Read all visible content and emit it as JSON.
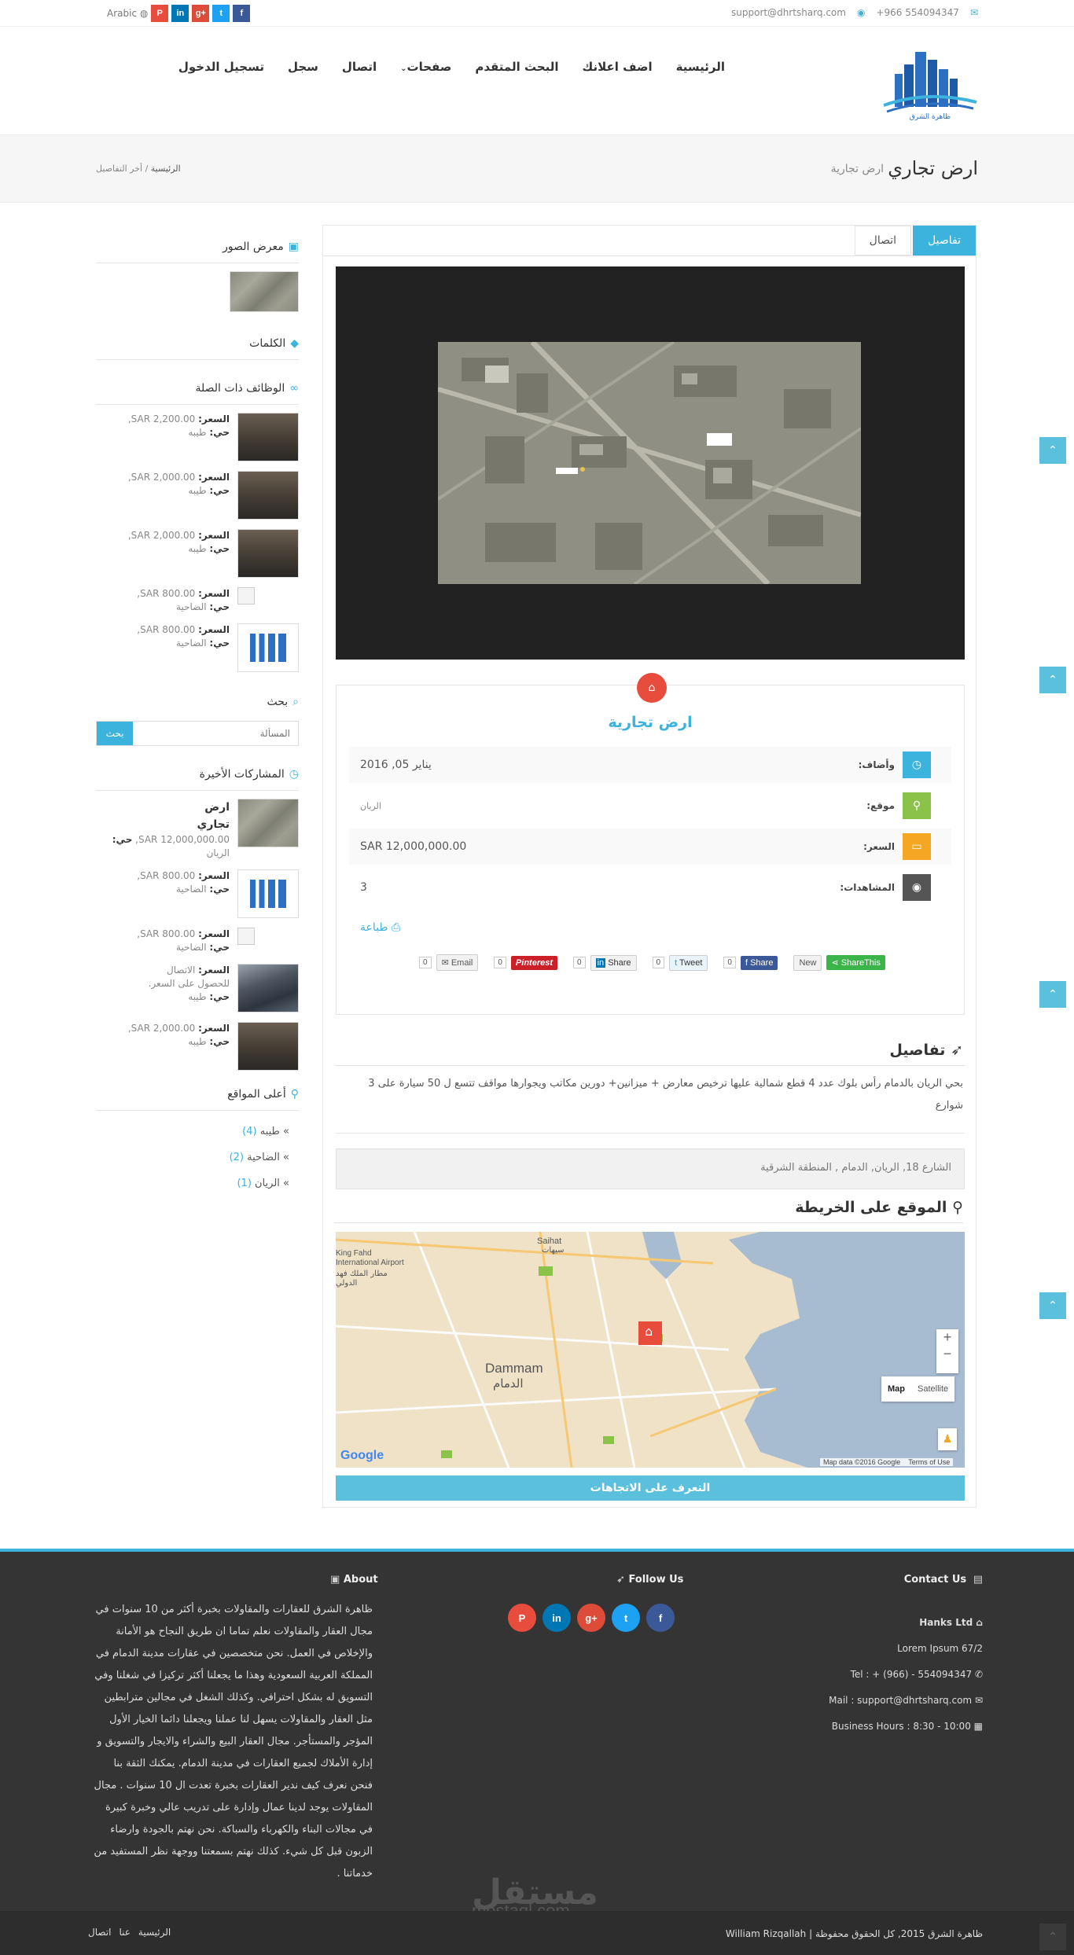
{
  "topbar": {
    "email": "support@dhrtsharq.com",
    "phone": "+966 554094347",
    "language": "Arabic",
    "socials": [
      "facebook-icon",
      "twitter-icon",
      "linkedin-icon",
      "google-plus-icon",
      "pinterest-icon"
    ]
  },
  "header": {
    "logo_alt": "ظاهرة الشرق",
    "nav": [
      "الرئيسية",
      "اضف اعلانك",
      "البحث المتقدم",
      "صفحات",
      "اتصال",
      "سجل",
      "تسجيل الدخول"
    ]
  },
  "title_band": {
    "title": "ارض تجاري",
    "subtitle": "ارض تجارية",
    "breadcrumb_home": "الرئيسية",
    "breadcrumb_sep": "/",
    "breadcrumb_current": "أخر التفاصيل"
  },
  "sidebar": {
    "gallery_title": "معرض الصور",
    "tags_title": "الكلمات",
    "related_title": "الوظائف ذات الصلة",
    "price_label": "السعر:",
    "district_label": "حي:",
    "related": [
      {
        "price": "SAR 2,200.00,",
        "district": "طيبه",
        "thumb": "room"
      },
      {
        "price": "SAR 2,000.00,",
        "district": "طيبه",
        "thumb": "room"
      },
      {
        "price": "SAR 2,000.00,",
        "district": "طيبه",
        "thumb": "room"
      },
      {
        "price": "SAR 800.00,",
        "district": "الضاحية",
        "thumb": "broken"
      },
      {
        "price": "SAR 800.00,",
        "district": "الضاحية",
        "thumb": "logo"
      }
    ],
    "search_title": "بحث",
    "search_placeholder": "المسألة",
    "search_button": "بحث",
    "recent_title": "المشاركات الأخيرة",
    "recent": [
      {
        "name": "ارض تجاري",
        "price": "SAR 12,000,000.00,",
        "district": "الريان",
        "thumb": "aerial"
      },
      {
        "name": "",
        "price": "SAR 800.00,",
        "district": "الضاحية",
        "thumb": "logo"
      },
      {
        "name": "",
        "price": "SAR 800.00,",
        "district": "الضاحية",
        "thumb": "broken"
      },
      {
        "name": "",
        "price": "الاتصال للحصول على السعر.",
        "district": "طيبه",
        "thumb": "building"
      },
      {
        "name": "",
        "price": "SAR 2,000.00,",
        "district": "طيبه",
        "thumb": "room"
      }
    ],
    "top_locations_title": "أعلى المواقع",
    "locations": [
      {
        "name": "طيبه",
        "count": "(4)"
      },
      {
        "name": "الضاحية",
        "count": "(2)"
      },
      {
        "name": "الريان",
        "count": "(1)"
      }
    ]
  },
  "main": {
    "tabs": [
      "تفاصيل",
      "اتصال"
    ],
    "property_title": "ارض تجارية",
    "rows": [
      {
        "label": "وأضاف:",
        "value": "يناير 05, 2016",
        "color": "#3bb3dd",
        "icon": "clock-icon"
      },
      {
        "label": "موقع:",
        "value": "الريان",
        "color": "#8bc34a",
        "icon": "map-pin-icon"
      },
      {
        "label": "السعر:",
        "value": "SAR 12,000,000.00",
        "color": "#f5a623",
        "icon": "money-icon"
      },
      {
        "label": "المشاهدات:",
        "value": "3",
        "color": "#555555",
        "icon": "eye-icon"
      }
    ],
    "print_label": "طباعة",
    "share": [
      {
        "label": "ShareThis",
        "color": "#3bb54a"
      },
      {
        "label": "New",
        "color": "#f2f2f2"
      },
      {
        "label": "Share",
        "count": "0",
        "color": "#3b5998"
      },
      {
        "label": "Tweet",
        "count": "0",
        "color": "#eaf4fb"
      },
      {
        "label": "Share",
        "count": "0",
        "color": "#f2f2f2"
      },
      {
        "label": "Pinterest",
        "count": "0",
        "color": "#cb2027"
      },
      {
        "label": "Email",
        "count": "0",
        "color": "#f2f2f2"
      }
    ],
    "description_title": "تفاصيل",
    "description": "بحي الريان بالدمام رأس بلوك عدد 4 قطع شمالية عليها ترخيص معارض + ميزانين+ دورين مكاتب ويجوارها مواقف تتسع ل 50 سيارة على 3 شوارع",
    "address": "الشارع 18, الريان, الدمام , المنطقة الشرقية",
    "map_title": "الموقع على الخريطة",
    "map_labels": {
      "saihat": "Saihat",
      "saihat_ar": "سيهات",
      "airport": "King Fahd International Airport",
      "airport_ar": "مطار الملك فهد الدولي",
      "dammam": "Dammam",
      "dammam_ar": "الدمام",
      "map_btn": "Map",
      "satellite_btn": "Satellite",
      "zoom_in": "+",
      "zoom_out": "−",
      "google": "Google",
      "mapdata": "Map data ©2016 Google",
      "terms": "Terms of Use"
    },
    "directions_button": "التعرف على الاتجاهات"
  },
  "footer": {
    "contact_title": "Contact Us",
    "company": "Hanks Ltd",
    "address": "Lorem Ipsum 67/2",
    "tel": "Tel : + (966) - 554094347",
    "mail": "Mail : support@dhrtsharq.com",
    "hours": "Business Hours : 8:30 - 10:00",
    "follow_title": "Follow Us",
    "about_title": "About",
    "about_text": "ظاهرة الشرق للعقارات والمقاولات بخبرة أكثر من 10 سنوات في مجال العقار والمقاولات نعلم تماما ان طريق النجاح هو الأمانة والإخلاص في العمل. نحن متخصصين في عقارات مدينة الدمام في المملكة العربية السعودية وهذا ما يجعلنا أكثر تركيزا في شغلنا وفي التسويق له بشكل احترافي. وكذلك الشغل في مجالين مترابطين مثل العقار والمقاولات يسهل لنا عملنا ويجعلنا دائما الخيار الأول المؤجر والمستأجر. مجال العقار البيع والشراء والايجار والتسويق و إدارة الأملاك لجميع العقارات في مدينة الدمام. يمكنك الثقة بنا فنحن نعرف كيف ندير العقارات بخبرة تعدت ال 10 سنوات . مجال المقاولات يوجد لدينا عمال وإدارة على تدريب عالي وخبرة كبيرة في مجالات البناء والكهرباء والسباكة. نحن نهتم بالجودة وارضاء الزبون قبل كل شيء. كذلك نهتم بسمعتنا ووجهة نظر المستفيد من خدماتنا .",
    "copyright": "ظاهرة الشرق 2015, كل الحقوق محفوظة | William Rizqallah",
    "bottom_nav": [
      "الرئيسية",
      "عنا",
      "اتصال"
    ],
    "watermark": "مستقل",
    "watermark_sub": "mostaql.com"
  },
  "colors": {
    "accent": "#3bb3dd",
    "facebook": "#3b5998",
    "twitter": "#1da1f2",
    "linkedin": "#0077b5",
    "googleplus": "#dd4b39",
    "pinterest": "#e74c3c"
  }
}
